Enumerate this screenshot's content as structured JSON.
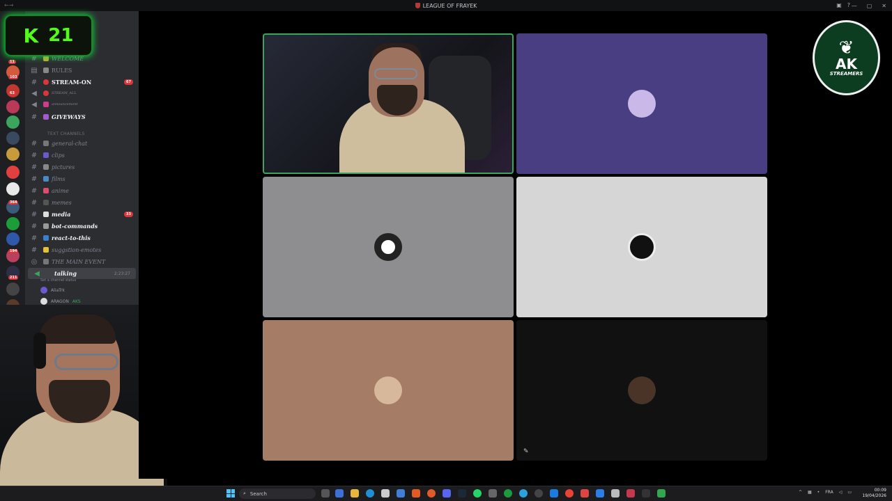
{
  "window": {
    "title": "LEAGUE OF FRAYEK"
  },
  "kick": {
    "viewer_count": "21",
    "logo_text": "K"
  },
  "server_badges": [
    "11",
    "103",
    "63",
    "2",
    "2",
    "4",
    "3",
    "1",
    "1",
    "364",
    "42",
    "194",
    "211",
    "8",
    "49"
  ],
  "channels": [
    {
      "name": "WELCOME",
      "type": "text",
      "style": "dim"
    },
    {
      "name": "RULES",
      "type": "text",
      "style": "normal"
    },
    {
      "name": "STREAM-ON",
      "type": "text",
      "style": "bold",
      "badge": "67"
    },
    {
      "name": "STREAM_ALL",
      "type": "voice",
      "style": "dim"
    },
    {
      "name": "announcement",
      "type": "voice",
      "style": "dim"
    },
    {
      "name": "GIVEWAYS",
      "type": "text",
      "style": "bold"
    },
    {
      "name": "TEXT CHANNELS",
      "type": "category"
    },
    {
      "name": "general-chat",
      "type": "text",
      "style": "normal"
    },
    {
      "name": "clips",
      "type": "text",
      "style": "normal"
    },
    {
      "name": "pictures",
      "type": "text",
      "style": "normal"
    },
    {
      "name": "films",
      "type": "text",
      "style": "normal"
    },
    {
      "name": "anime",
      "type": "text",
      "style": "normal"
    },
    {
      "name": "memes",
      "type": "text",
      "style": "normal"
    },
    {
      "name": "media",
      "type": "text",
      "style": "bold",
      "badge": "33"
    },
    {
      "name": "bot-commands",
      "type": "text",
      "style": "bold"
    },
    {
      "name": "react-to-this",
      "type": "text",
      "style": "bold"
    },
    {
      "name": "suggstion-emotes",
      "type": "text",
      "style": "normal"
    },
    {
      "name": "THE MAIN EVENT",
      "type": "stage",
      "style": "normal"
    },
    {
      "name": "talking",
      "type": "voice",
      "style": "active",
      "time": "2:23:27",
      "status": "Set a channel status"
    }
  ],
  "voice_users": [
    {
      "name": "AliaTrk",
      "avatar_color": "#6a5acd"
    },
    {
      "name": "ARAGON",
      "tag": "AKS",
      "avatar_color": "#dddddd"
    }
  ],
  "stage_tiles": [
    {
      "kind": "camera",
      "color": "#1c1e26",
      "speaking": true
    },
    {
      "kind": "avatar",
      "color": "#4a3e82",
      "avatar_color": "#c9b8e8"
    },
    {
      "kind": "avatar",
      "color": "#8e8e91",
      "avatar_color": "#222222"
    },
    {
      "kind": "avatar",
      "color": "#d6d6d6",
      "avatar_color": "#111111"
    },
    {
      "kind": "avatar",
      "color": "#a57d66",
      "avatar_color": "#d8b89a"
    },
    {
      "kind": "avatar",
      "color": "#111111",
      "avatar_color": "#4a3428",
      "muted": true
    }
  ],
  "ak_logo": {
    "line1": "AK",
    "line2": "STREAMERS"
  },
  "taskbar": {
    "search_label": "Search",
    "lang": "FRA",
    "time": "00:09",
    "date": "19/04/2026"
  },
  "colors": {
    "accent_green": "#3ba55d",
    "kick_green": "#53fc18",
    "badge_red": "#da373c"
  }
}
